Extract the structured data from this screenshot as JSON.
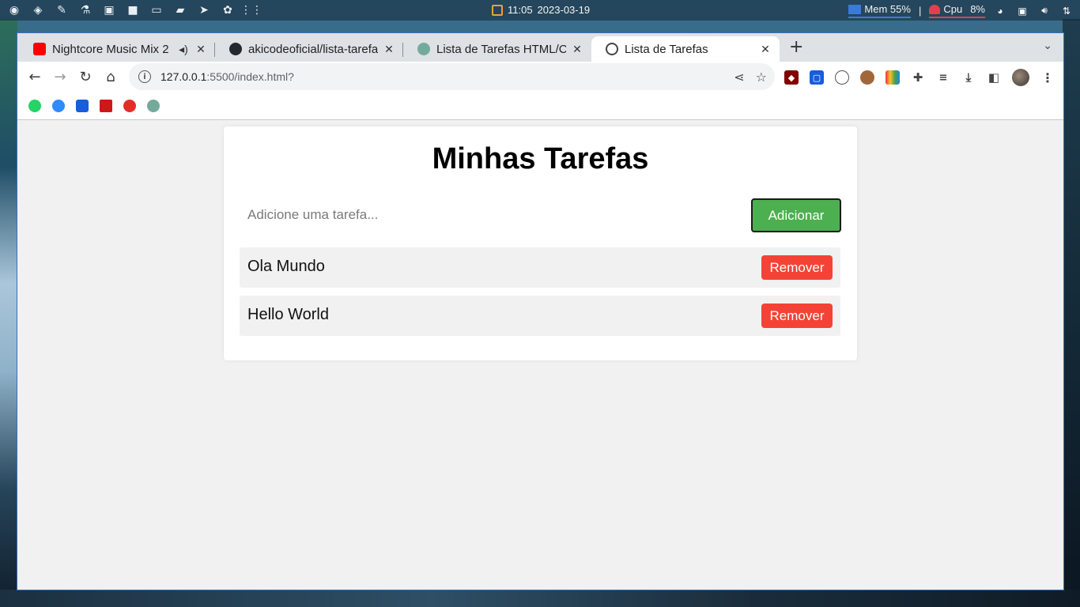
{
  "taskbar": {
    "clock_time": "11:05",
    "clock_date": "2023-03-19",
    "mem_label": "Mem 55%",
    "separator": "|",
    "cpu_label": "Cpu",
    "cpu_value": "8%"
  },
  "browser": {
    "tabs": [
      {
        "title": "Nightcore Music Mix 2",
        "favicon": "youtube-icon",
        "color": "#ff0000"
      },
      {
        "title": "akicodeoficial/lista-tarefa",
        "favicon": "github-icon",
        "color": "#24292f"
      },
      {
        "title": "Lista de Tarefas HTML/CS",
        "favicon": "chatgpt-icon",
        "color": "#74aa9c"
      },
      {
        "title": "Lista de Tarefas",
        "favicon": "globe-icon",
        "color": "#444444"
      }
    ],
    "new_tab": "+",
    "url_host": "127.0.0.1",
    "url_rest": ":5500/index.html?"
  },
  "page": {
    "heading": "Minhas Tarefas",
    "input_placeholder": "Adicione uma tarefa...",
    "add_label": "Adicionar",
    "tasks": [
      {
        "text": "Ola Mundo",
        "remove_label": "Remover"
      },
      {
        "text": "Hello World",
        "remove_label": "Remover"
      }
    ]
  },
  "colors": {
    "add_button": "#4caf50",
    "remove_button": "#f44336",
    "page_background": "#f1f1f1"
  }
}
